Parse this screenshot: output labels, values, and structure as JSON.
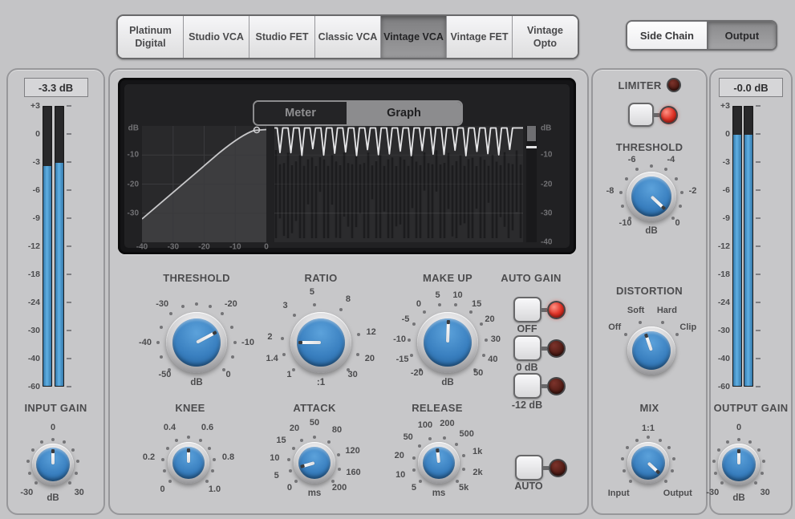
{
  "model_tabs": [
    {
      "label": "Platinum Digital",
      "selected": false
    },
    {
      "label": "Studio VCA",
      "selected": false
    },
    {
      "label": "Studio FET",
      "selected": false
    },
    {
      "label": "Classic VCA",
      "selected": false
    },
    {
      "label": "Vintage VCA",
      "selected": true
    },
    {
      "label": "Vintage FET",
      "selected": false
    },
    {
      "label": "Vintage Opto",
      "selected": false
    }
  ],
  "view_toggle": {
    "side_chain": "Side Chain",
    "output": "Output",
    "selected": "Output"
  },
  "input_meter": {
    "readout": "-3.3 dB",
    "label": "INPUT GAIN",
    "scale": [
      "+3",
      "0",
      "-3",
      "-6",
      "-9",
      "-12",
      "-18",
      "-24",
      "-30",
      "-40",
      "-60"
    ],
    "fill_left_pct": 78.3,
    "fill_right_pct": 79.5
  },
  "output_meter": {
    "readout": "-0.0 dB",
    "label": "OUTPUT GAIN",
    "scale": [
      "+3",
      "0",
      "-3",
      "-6",
      "-9",
      "-12",
      "-18",
      "-24",
      "-30",
      "-40",
      "-60"
    ],
    "fill_left_pct": 89.5,
    "fill_right_pct": 89.5
  },
  "display": {
    "view_tabs": [
      {
        "label": "Meter",
        "selected": false
      },
      {
        "label": "Graph",
        "selected": true
      }
    ],
    "curve_y_labels": [
      "dB",
      "-10",
      "-20",
      "-30"
    ],
    "curve_x_labels": [
      "-40",
      "-30",
      "-20",
      "-10",
      "0"
    ],
    "history_y_labels": [
      "dB",
      "-10",
      "-20",
      "-30",
      "-40"
    ]
  },
  "auto_gain": {
    "title": "AUTO GAIN",
    "buttons": [
      {
        "label": "OFF",
        "led": "on"
      },
      {
        "label": "0 dB",
        "led": "off"
      },
      {
        "label": "-12 dB",
        "led": "off"
      }
    ]
  },
  "auto_release": {
    "label": "AUTO",
    "led": "off"
  },
  "limiter": {
    "title": "LIMITER",
    "header_led": "off",
    "button_led": "on"
  },
  "knobs": {
    "threshold": {
      "label": "THRESHOLD",
      "unit": "dB",
      "uo": 50,
      "pointer": 62,
      "ticks": [
        {
          "t": "-50",
          "a": -135,
          "lr": 56
        },
        {
          "t": "",
          "a": -112
        },
        {
          "t": "-40",
          "a": -90
        },
        {
          "t": "",
          "a": -67
        },
        {
          "t": "-30",
          "a": -42
        },
        {
          "t": "",
          "a": -21
        },
        {
          "t": "",
          "a": 0
        },
        {
          "t": "",
          "a": 21
        },
        {
          "t": "-20",
          "a": 42
        },
        {
          "t": "",
          "a": 67
        },
        {
          "t": "-10",
          "a": 90
        },
        {
          "t": "",
          "a": 112
        },
        {
          "t": "0",
          "a": 135,
          "lr": 56
        }
      ]
    },
    "ratio": {
      "label": "RATIO",
      "unit": ":1",
      "uo": 50,
      "pointer": -90,
      "ticks": [
        {
          "t": "1",
          "a": -135,
          "lr": 56
        },
        {
          "t": "1.4",
          "a": -108
        },
        {
          "t": "2",
          "a": -84
        },
        {
          "t": "3",
          "a": -44
        },
        {
          "t": "5",
          "a": -10
        },
        {
          "t": "8",
          "a": 32
        },
        {
          "t": "12",
          "a": 78
        },
        {
          "t": "20",
          "a": 108
        },
        {
          "t": "30",
          "a": 135,
          "lr": 56
        }
      ]
    },
    "makeup": {
      "label": "MAKE UP",
      "unit": "dB",
      "uo": 50,
      "pointer": 2,
      "ticks": [
        {
          "t": "-20",
          "a": -135,
          "lr": 54
        },
        {
          "t": "-15",
          "a": -110
        },
        {
          "t": "-10",
          "a": -86
        },
        {
          "t": "-5",
          "a": -61
        },
        {
          "t": "0",
          "a": -37
        },
        {
          "t": "5",
          "a": -12
        },
        {
          "t": "10",
          "a": 12
        },
        {
          "t": "15",
          "a": 37
        },
        {
          "t": "20",
          "a": 61
        },
        {
          "t": "30",
          "a": 86
        },
        {
          "t": "40",
          "a": 110
        },
        {
          "t": "50",
          "a": 135,
          "lr": 54
        }
      ]
    },
    "knee": {
      "label": "KNEE",
      "unit": "",
      "uo": 0,
      "pointer": 0,
      "ticks": [
        {
          "t": "0",
          "a": -135,
          "lr": 46
        },
        {
          "t": "",
          "a": -108
        },
        {
          "t": "0.2",
          "a": -82
        },
        {
          "t": "",
          "a": -55
        },
        {
          "t": "0.4",
          "a": -28
        },
        {
          "t": "",
          "a": 0
        },
        {
          "t": "0.6",
          "a": 28
        },
        {
          "t": "",
          "a": 55
        },
        {
          "t": "0.8",
          "a": 82
        },
        {
          "t": "",
          "a": 108
        },
        {
          "t": "1.0",
          "a": 135,
          "lr": 46
        }
      ]
    },
    "attack": {
      "label": "ATTACK",
      "unit": "ms",
      "uo": 38,
      "pointer": -106,
      "ticks": [
        {
          "t": "0",
          "a": -135,
          "lr": 44
        },
        {
          "t": "5",
          "a": -109
        },
        {
          "t": "10",
          "a": -83
        },
        {
          "t": "15",
          "a": -56
        },
        {
          "t": "20",
          "a": -30
        },
        {
          "t": "50",
          "a": 0
        },
        {
          "t": "80",
          "a": 34
        },
        {
          "t": "120",
          "a": 72
        },
        {
          "t": "160",
          "a": 104
        },
        {
          "t": "200",
          "a": 135,
          "lr": 44
        }
      ]
    },
    "release": {
      "label": "RELEASE",
      "unit": "ms",
      "uo": 38,
      "pointer": -6,
      "ticks": [
        {
          "t": "5",
          "a": -135,
          "lr": 44
        },
        {
          "t": "10",
          "a": -107
        },
        {
          "t": "20",
          "a": -80
        },
        {
          "t": "50",
          "a": -50
        },
        {
          "t": "100",
          "a": -20
        },
        {
          "t": "200",
          "a": 12
        },
        {
          "t": "500",
          "a": 44
        },
        {
          "t": "1k",
          "a": 74
        },
        {
          "t": "2k",
          "a": 104
        },
        {
          "t": "5k",
          "a": 135,
          "lr": 44
        }
      ]
    },
    "limiter_threshold": {
      "label": "THRESHOLD",
      "unit": "dB",
      "uo": 43,
      "pointer": 133,
      "ticks": [
        {
          "t": "-10",
          "a": -135,
          "lr": 46
        },
        {
          "t": "",
          "a": -108
        },
        {
          "t": "-8",
          "a": -82
        },
        {
          "t": "",
          "a": -55
        },
        {
          "t": "-6",
          "a": -28
        },
        {
          "t": "",
          "a": 0
        },
        {
          "t": "-4",
          "a": 28
        },
        {
          "t": "",
          "a": 55
        },
        {
          "t": "-2",
          "a": 82
        },
        {
          "t": "",
          "a": 108
        },
        {
          "t": "0",
          "a": 135,
          "lr": 46
        }
      ]
    },
    "distortion": {
      "label": "DISTORTION",
      "unit": "",
      "uo": 0,
      "pointer": -19,
      "ticks": [
        {
          "t": "Off",
          "a": -58
        },
        {
          "t": "Soft",
          "a": -21
        },
        {
          "t": "Hard",
          "a": 21
        },
        {
          "t": "Clip",
          "a": 58
        }
      ]
    },
    "mix": {
      "label": "MIX",
      "unit": "",
      "uo": 0,
      "pointer": 133,
      "ticks": [
        {
          "t": "Input",
          "a": -136,
          "lr": 53
        },
        {
          "t": "",
          "a": -108
        },
        {
          "t": "",
          "a": -81
        },
        {
          "t": "",
          "a": -54
        },
        {
          "t": "",
          "a": -27
        },
        {
          "t": "1:1",
          "a": 0,
          "lr": 43
        },
        {
          "t": "",
          "a": 27
        },
        {
          "t": "",
          "a": 54
        },
        {
          "t": "",
          "a": 81
        },
        {
          "t": "",
          "a": 108
        },
        {
          "t": "Output",
          "a": 136,
          "lr": 53
        }
      ]
    },
    "input_gain": {
      "label": "INPUT GAIN",
      "unit": "dB",
      "uo": 42,
      "pointer": 0,
      "ticks": [
        {
          "t": "-30",
          "a": -137,
          "lr": 48
        },
        {
          "t": "",
          "a": -110
        },
        {
          "t": "",
          "a": -82
        },
        {
          "t": "",
          "a": -55
        },
        {
          "t": "",
          "a": -27
        },
        {
          "t": "0",
          "a": 0,
          "lr": 46
        },
        {
          "t": "",
          "a": 27
        },
        {
          "t": "",
          "a": 55
        },
        {
          "t": "",
          "a": 82
        },
        {
          "t": "",
          "a": 110
        },
        {
          "t": "30",
          "a": 137,
          "lr": 48
        }
      ]
    },
    "output_gain": {
      "label": "OUTPUT GAIN",
      "unit": "dB",
      "uo": 42,
      "pointer": 0,
      "ticks": [
        {
          "t": "-30",
          "a": -137,
          "lr": 48
        },
        {
          "t": "",
          "a": -110
        },
        {
          "t": "",
          "a": -82
        },
        {
          "t": "",
          "a": -55
        },
        {
          "t": "",
          "a": -27
        },
        {
          "t": "0",
          "a": 0,
          "lr": 46
        },
        {
          "t": "",
          "a": 27
        },
        {
          "t": "",
          "a": 55
        },
        {
          "t": "",
          "a": 82
        },
        {
          "t": "",
          "a": 110
        },
        {
          "t": "30",
          "a": 137,
          "lr": 48
        }
      ]
    }
  },
  "colors": {
    "knob_blue": "#3a80c0",
    "meter_blue": "#4a9fd6",
    "led_on": "#e03428",
    "led_off": "#571f18"
  }
}
